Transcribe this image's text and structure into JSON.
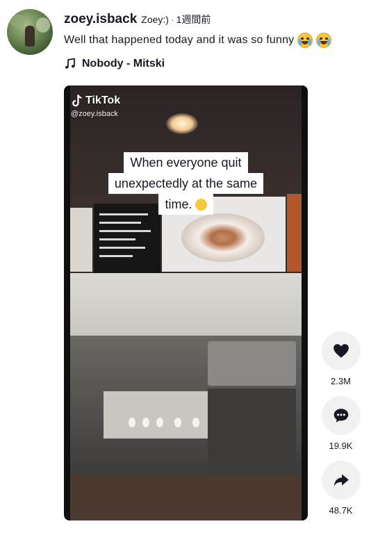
{
  "author": {
    "username": "zoey.isback",
    "nickname": "Zoey:)",
    "separator": "·",
    "posted": "1週間前"
  },
  "caption": "Well that happened today and it was so funny",
  "music": "Nobody - Mitski",
  "video": {
    "watermark_brand": "TikTok",
    "watermark_handle": "@zoey.isback",
    "overlay_lines": [
      "When everyone quit",
      "unexpectedly at the same",
      "time."
    ]
  },
  "actions": {
    "likes": "2.3M",
    "comments": "19.9K",
    "shares": "48.7K"
  },
  "icons": {
    "like": "heart-icon",
    "comment": "comment-icon",
    "share": "share-icon",
    "music": "music-note-icon",
    "brand": "tiktok-logo-icon"
  }
}
